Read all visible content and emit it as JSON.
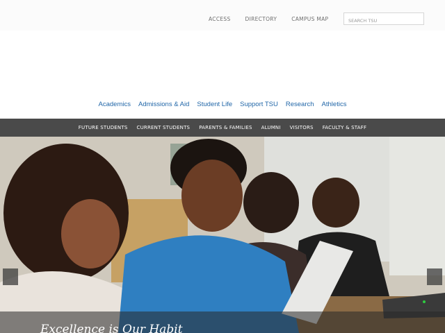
{
  "utility": {
    "links": [
      "ACCESS",
      "DIRECTORY",
      "CAMPUS MAP"
    ],
    "search_placeholder": "SEARCH TSU"
  },
  "main_nav": [
    "Academics",
    "Admissions & Aid",
    "Student Life",
    "Support TSU",
    "Research",
    "Athletics"
  ],
  "audience_nav": [
    "FUTURE STUDENTS",
    "CURRENT STUDENTS",
    "PARENTS & FAMILIES",
    "ALUMNI",
    "VISITORS",
    "FACULTY & STAFF"
  ],
  "hero": {
    "caption": "Excellence is Our Habit"
  },
  "colors": {
    "nav_link": "#2267a8",
    "audience_bar": "#4a4a4a",
    "utility_text": "#6f6f6f"
  }
}
